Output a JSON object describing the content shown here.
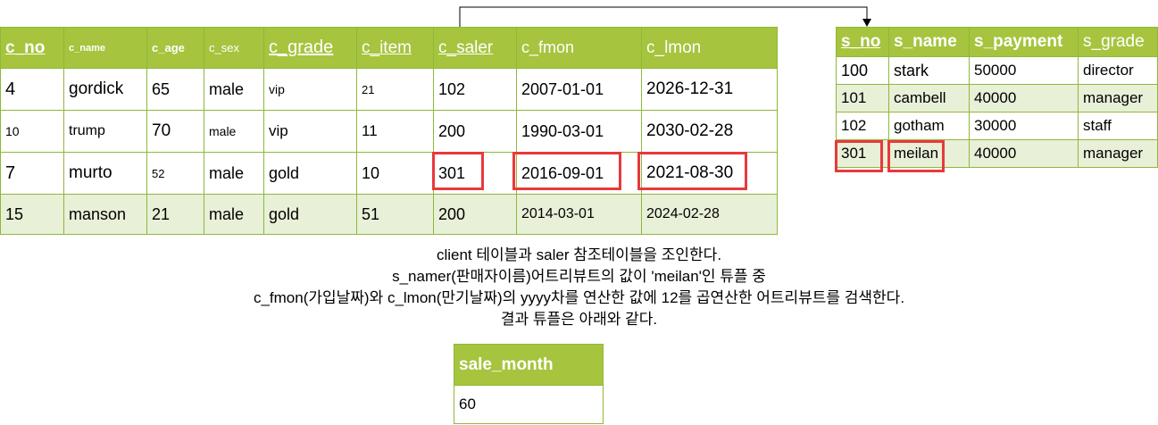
{
  "client_table": {
    "headers": [
      "c_no",
      "c_name",
      "c_age",
      "c_sex",
      "c_grade",
      "c_item",
      "c_saler",
      "c_fmon",
      "c_lmon"
    ],
    "rows": [
      [
        "4",
        "gordick",
        "65",
        "male",
        "vip",
        "21",
        "102",
        "2007-01-01",
        "2026-12-31"
      ],
      [
        "10",
        "trump",
        "70",
        "male",
        "vip",
        "11",
        "200",
        "1990-03-01",
        "2030-02-28"
      ],
      [
        "7",
        "murto",
        "52",
        "male",
        "gold",
        "10",
        "301",
        "2016-09-01",
        "2021-08-30"
      ],
      [
        "15",
        "manson",
        "21",
        "male",
        "gold",
        "51",
        "200",
        "2014-03-01",
        "2024-02-28"
      ]
    ]
  },
  "saler_table": {
    "headers": [
      "s_no",
      "s_name",
      "s_payment",
      "s_grade"
    ],
    "rows": [
      [
        "100",
        "stark",
        "50000",
        "director"
      ],
      [
        "101",
        "cambell",
        "40000",
        "manager"
      ],
      [
        "102",
        "gotham",
        "30000",
        "staff"
      ],
      [
        "301",
        "meilan",
        "40000",
        "manager"
      ]
    ]
  },
  "description": [
    "client 테이블과 saler 참조테이블을 조인한다.",
    "s_namer(판매자이름)어트리뷰트의 값이 'meilan'인 튜플 중",
    "c_fmon(가입날짜)와 c_lmon(만기날짜)의 yyyy차를 연산한 값에 12를 곱연산한 어트리뷰트를 검색한다.",
    "결과 튜플은 아래와 같다."
  ],
  "result_table": {
    "header": "sale_month",
    "value": "60"
  },
  "colors": {
    "header_green": "#a6c43e",
    "row_tint": "#e8f0d8",
    "border": "#8fb83a",
    "highlight_red": "#e8393b"
  }
}
